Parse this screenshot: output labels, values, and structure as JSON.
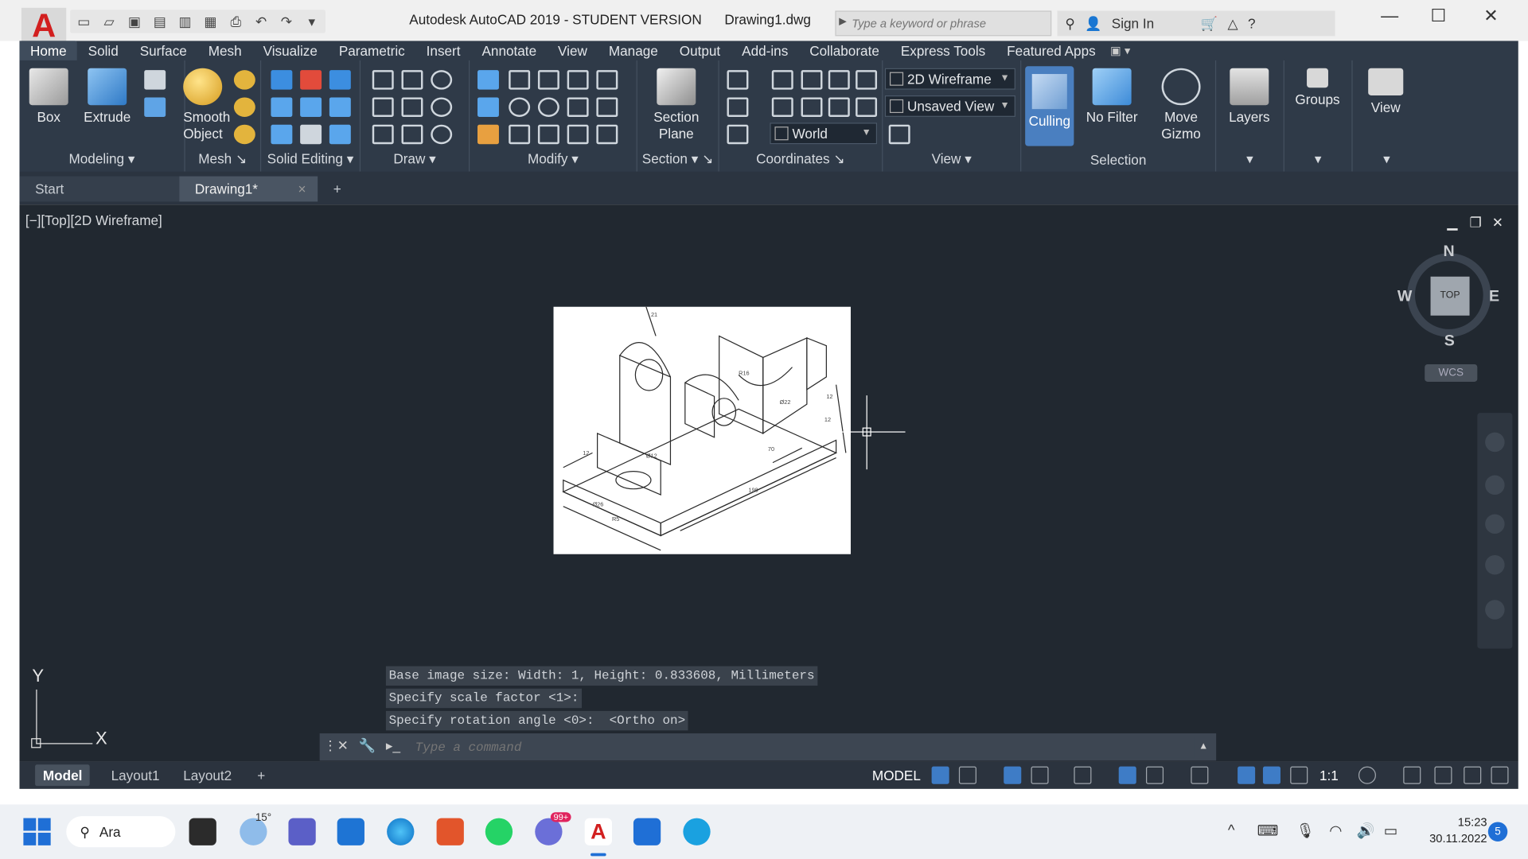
{
  "app": {
    "logo_letter": "A",
    "title": "Autodesk AutoCAD 2019 - STUDENT VERSION",
    "filename": "Drawing1.dwg",
    "search_placeholder": "Type a keyword or phrase",
    "sign_in": "Sign In"
  },
  "ribbon": {
    "tabs": [
      "Home",
      "Solid",
      "Surface",
      "Mesh",
      "Visualize",
      "Parametric",
      "Insert",
      "Annotate",
      "View",
      "Manage",
      "Output",
      "Add-ins",
      "Collaborate",
      "Express Tools",
      "Featured Apps"
    ],
    "active_tab": "Home",
    "buttons": {
      "box": "Box",
      "extrude": "Extrude",
      "smooth_object": "Smooth Object",
      "section_plane": "Section Plane",
      "culling": "Culling",
      "no_filter": "No Filter",
      "move_gizmo": "Move Gizmo",
      "layers": "Layers",
      "groups": "Groups",
      "view": "View"
    },
    "panels": {
      "modeling": "Modeling",
      "mesh": "Mesh",
      "solid_editing": "Solid Editing",
      "draw": "Draw",
      "modify": "Modify",
      "section": "Section",
      "coordinates": "Coordinates",
      "view": "View",
      "selection": "Selection"
    },
    "dropdowns": {
      "visual_style": "2D Wireframe",
      "named_view": "Unsaved View",
      "ucs": "World"
    }
  },
  "file_tabs": {
    "start": "Start",
    "drawing": "Drawing1*",
    "close": "×",
    "add": "+"
  },
  "viewport": {
    "label": "[−][Top][2D Wireframe]",
    "viewcube": {
      "top": "TOP",
      "n": "N",
      "s": "S",
      "e": "E",
      "w": "W",
      "wcs": "WCS"
    },
    "ucs_x": "X",
    "ucs_y": "Y"
  },
  "command": {
    "history": [
      "Base image size: Width: 1, Height: 0.833608, Millimeters",
      "Specify scale factor <1>:",
      "Specify rotation angle <0>:  <Ortho on>"
    ],
    "placeholder": "Type a command"
  },
  "status": {
    "layout_tabs": [
      "Model",
      "Layout1",
      "Layout2"
    ],
    "active_layout": "Model",
    "add": "+",
    "model_label": "MODEL",
    "annotation_scale": "1:1"
  },
  "taskbar": {
    "search_label": "Ara",
    "weather": "15°",
    "time": "15:23",
    "date": "30.11.2022",
    "notifications": "5",
    "badge": "99+"
  },
  "colors": {
    "ribbon_bg": "#2f3a48",
    "drawing_bg": "#212830",
    "accent": "#3e7cc6",
    "logo_red": "#d21f1f"
  }
}
